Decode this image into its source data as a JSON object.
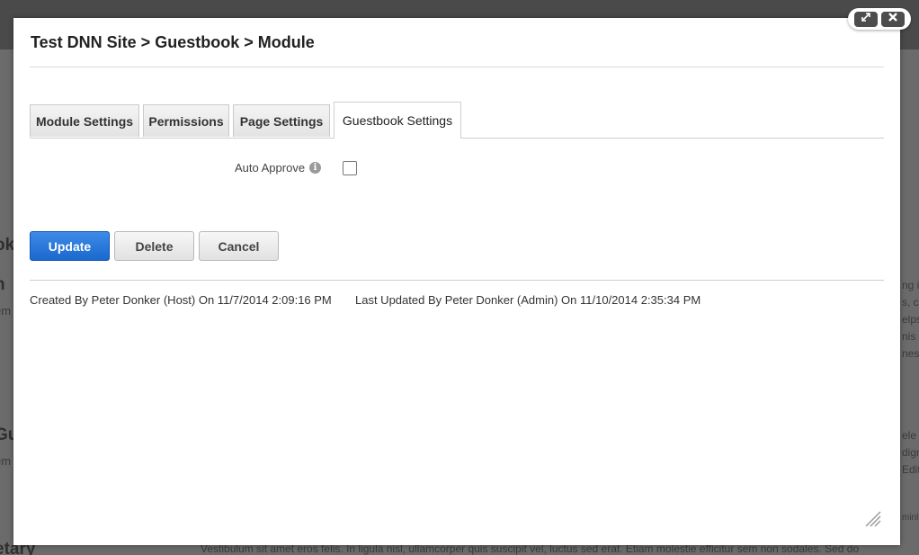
{
  "background": {
    "fragments": [
      "ok",
      "n",
      "em",
      "Gu",
      "em",
      "etary"
    ],
    "right_fragments": [
      "ng it",
      "s, c",
      "elpsu",
      "nis l",
      "nes",
      "ele",
      "dign",
      "Edit",
      "minl"
    ],
    "footer_text": "Vestibulum sit amet eros felis. In ligula nisl, ullamcorper quis suscipit vel, luctus sed erat. Etiam molestie efficitur sem non sodales. Sed do"
  },
  "window_controls": {
    "maximize_icon": "expand-icon",
    "close_icon": "close-icon"
  },
  "dialog": {
    "title": "Test DNN Site > Guestbook > Module"
  },
  "tabs": [
    {
      "label": "Module Settings",
      "active": false
    },
    {
      "label": "Permissions",
      "active": false
    },
    {
      "label": "Page Settings",
      "active": false
    },
    {
      "label": "Guestbook Settings",
      "active": true
    }
  ],
  "form": {
    "auto_approve_label": "Auto Approve",
    "auto_approve_checked": false,
    "info_icon_glyph": "i"
  },
  "actions": {
    "update_label": "Update",
    "delete_label": "Delete",
    "cancel_label": "Cancel"
  },
  "audit": {
    "created": "Created By Peter Donker (Host) On 11/7/2014 2:09:16 PM",
    "updated": "Last Updated By Peter Donker (Admin) On 11/10/2014 2:35:34 PM"
  },
  "colors": {
    "primary_button": "#1b68cf",
    "overlay": "#5a5a5a"
  }
}
